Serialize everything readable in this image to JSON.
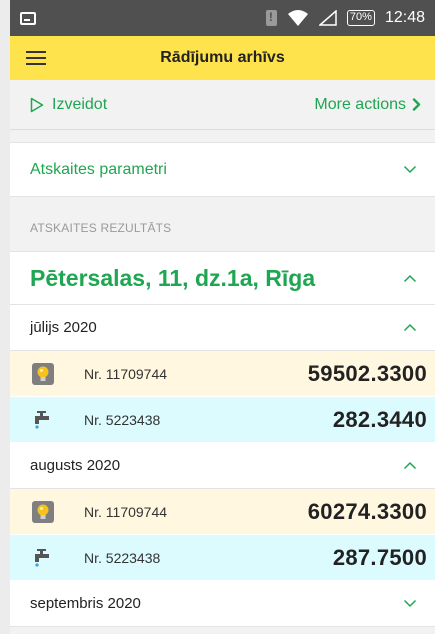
{
  "status_bar": {
    "battery": "70%",
    "time": "12:48"
  },
  "app_bar": {
    "title": "Rādījumu arhīvs"
  },
  "actions": {
    "create_label": "Izveidot",
    "more_label": "More actions"
  },
  "report_params": {
    "label": "Atskaites parametri"
  },
  "results": {
    "section_label": "ATSKAITES REZULTĀTS",
    "address": "Pētersalas, 11, dz.1a, Rīga",
    "months": [
      {
        "label": "jūlijs 2020",
        "meters": [
          {
            "type": "electricity",
            "icon": "lightbulb-icon",
            "number": "Nr. 11709744",
            "value": "59502.3300"
          },
          {
            "type": "water",
            "icon": "water-tap-icon",
            "number": "Nr. 5223438",
            "value": "282.3440"
          }
        ]
      },
      {
        "label": "augusts 2020",
        "meters": [
          {
            "type": "electricity",
            "icon": "lightbulb-icon",
            "number": "Nr. 11709744",
            "value": "60274.3300"
          },
          {
            "type": "water",
            "icon": "water-tap-icon",
            "number": "Nr. 5223438",
            "value": "287.7500"
          }
        ]
      },
      {
        "label": "septembris 2020",
        "meters": []
      }
    ]
  },
  "colors": {
    "accent_green": "#1fa652",
    "app_bar_yellow": "#ffe34d",
    "electricity_row": "#fff7df",
    "water_row": "#dcfbff"
  }
}
